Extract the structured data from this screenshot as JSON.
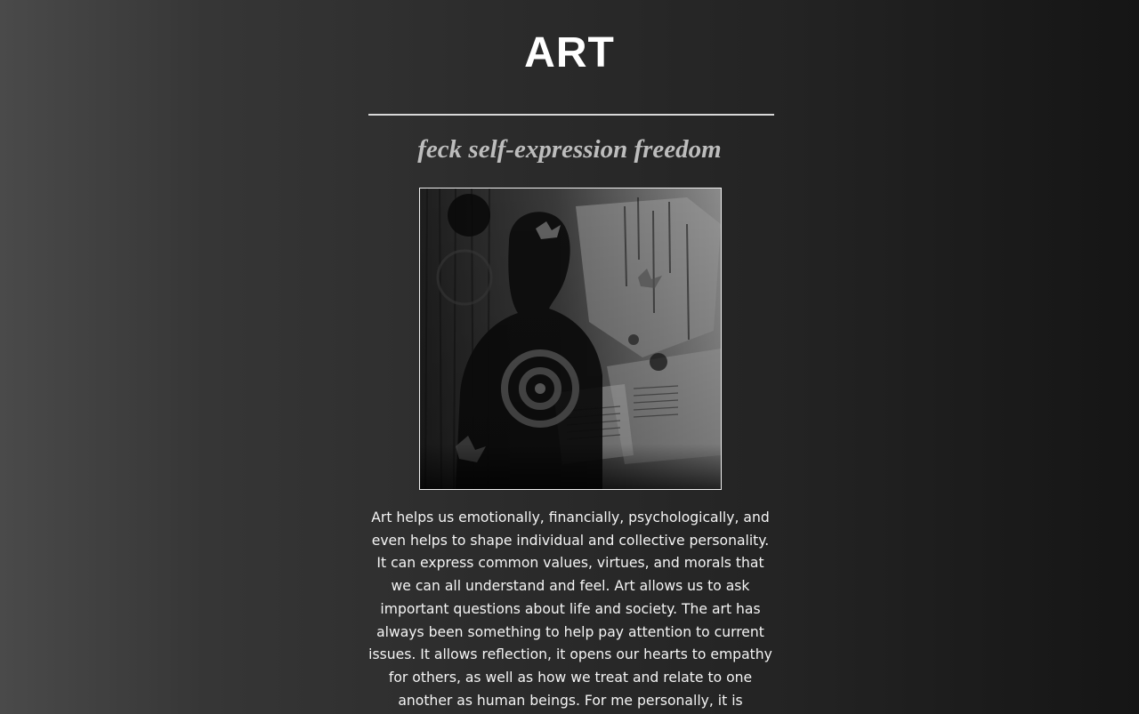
{
  "page": {
    "title": "ART",
    "subtitle": "feck self-expression freedom",
    "artwork_icon": "collage-artwork-image",
    "body": "Art helps us emotionally, financially, psychologically, and even helps to shape individual and collective personality. It can express common values, virtues, and morals that we can all understand and feel. Art allows us to ask important questions about life and society. The art has always been something to help pay attention to current issues. It allows reflection, it opens our hearts to empathy for others, as well as how we treat and relate to one another as human beings. For me personally, it is something what insipes me, as a result"
  },
  "colors": {
    "background_left": "#4a4a4a",
    "background_right": "#151515",
    "title": "#ffffff",
    "subtitle": "#bdbdbd",
    "rule": "#d8d8d8"
  }
}
